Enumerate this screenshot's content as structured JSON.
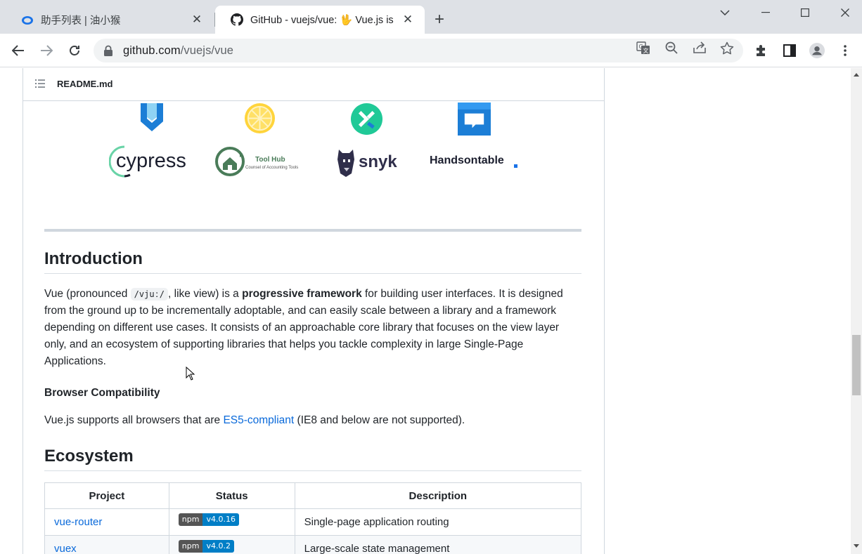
{
  "browser": {
    "tabs": [
      {
        "title": "助手列表 | 油小猴",
        "active": false
      },
      {
        "title": "GitHub - vuejs/vue: 🖖 Vue.js is",
        "active": true
      }
    ],
    "url_domain": "github.com",
    "url_path": "/vuejs/vue"
  },
  "readme": {
    "filename": "README.md"
  },
  "sponsors_top": [
    "vuejs-shield-logo",
    "lemon-logo",
    "exchange-arrows-logo",
    "chat-bubble-logo"
  ],
  "sponsors_bottom": {
    "cypress": "cypress",
    "toolhub_title": "Tool Hub",
    "toolhub_sub": "Counsel of Accounting Tools",
    "snyk": "snyk",
    "handsontable": "Handsontable"
  },
  "intro": {
    "heading": "Introduction",
    "p_before_code": "Vue (pronounced ",
    "code": "/vjuː/",
    "p_after_code": ", like view) is a ",
    "bold": "progressive framework",
    "p_rest": " for building user interfaces. It is designed from the ground up to be incrementally adoptable, and can easily scale between a library and a framework depending on different use cases. It consists of an approachable core library that focuses on the view layer only, and an ecosystem of supporting libraries that helps you tackle complexity in large Single-Page Applications.",
    "compat_heading": "Browser Compatibility",
    "compat_before": "Vue.js supports all browsers that are ",
    "compat_link": "ES5-compliant",
    "compat_after": " (IE8 and below are not supported)."
  },
  "ecosystem": {
    "heading": "Ecosystem",
    "columns": [
      "Project",
      "Status",
      "Description"
    ],
    "rows": [
      {
        "project": "vue-router",
        "badge_label": "npm",
        "badge_version": "v4.0.16",
        "description": "Single-page application routing"
      },
      {
        "project": "vuex",
        "badge_label": "npm",
        "badge_version": "v4.0.2",
        "description": "Large-scale state management"
      }
    ]
  }
}
